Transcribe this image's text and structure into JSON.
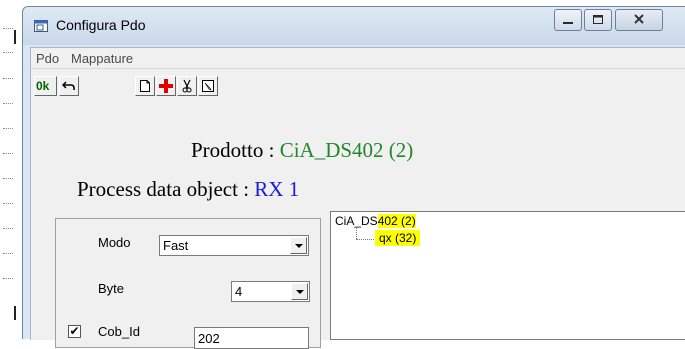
{
  "window": {
    "title": "Configura Pdo"
  },
  "menu": {
    "items": [
      "Pdo",
      "Mappature"
    ]
  },
  "toolbar": {
    "ok_label": "0k",
    "buttons": [
      "ok-icon",
      "undo-icon",
      "new-icon",
      "add-icon",
      "cut-icon",
      "properties-icon"
    ]
  },
  "header": {
    "prodotto_label": "Prodotto : ",
    "prodotto_value": "CiA_DS402 (2)",
    "pdo_label": "Process data object : ",
    "pdo_value": "RX 1"
  },
  "form": {
    "modo_label": "Modo",
    "modo_value": "Fast",
    "byte_label": "Byte",
    "byte_value": "4",
    "cobid_label": "Cob_Id",
    "cobid_checked": true,
    "cobid_value": "202"
  },
  "tree": {
    "root_prefix": "CiA_DS",
    "root_suffix": "402 (2)",
    "child": "qx (32)"
  },
  "colors": {
    "prodotto_value": "#22882a",
    "pdo_value": "#1a1adc",
    "highlight": "#ffff00"
  }
}
